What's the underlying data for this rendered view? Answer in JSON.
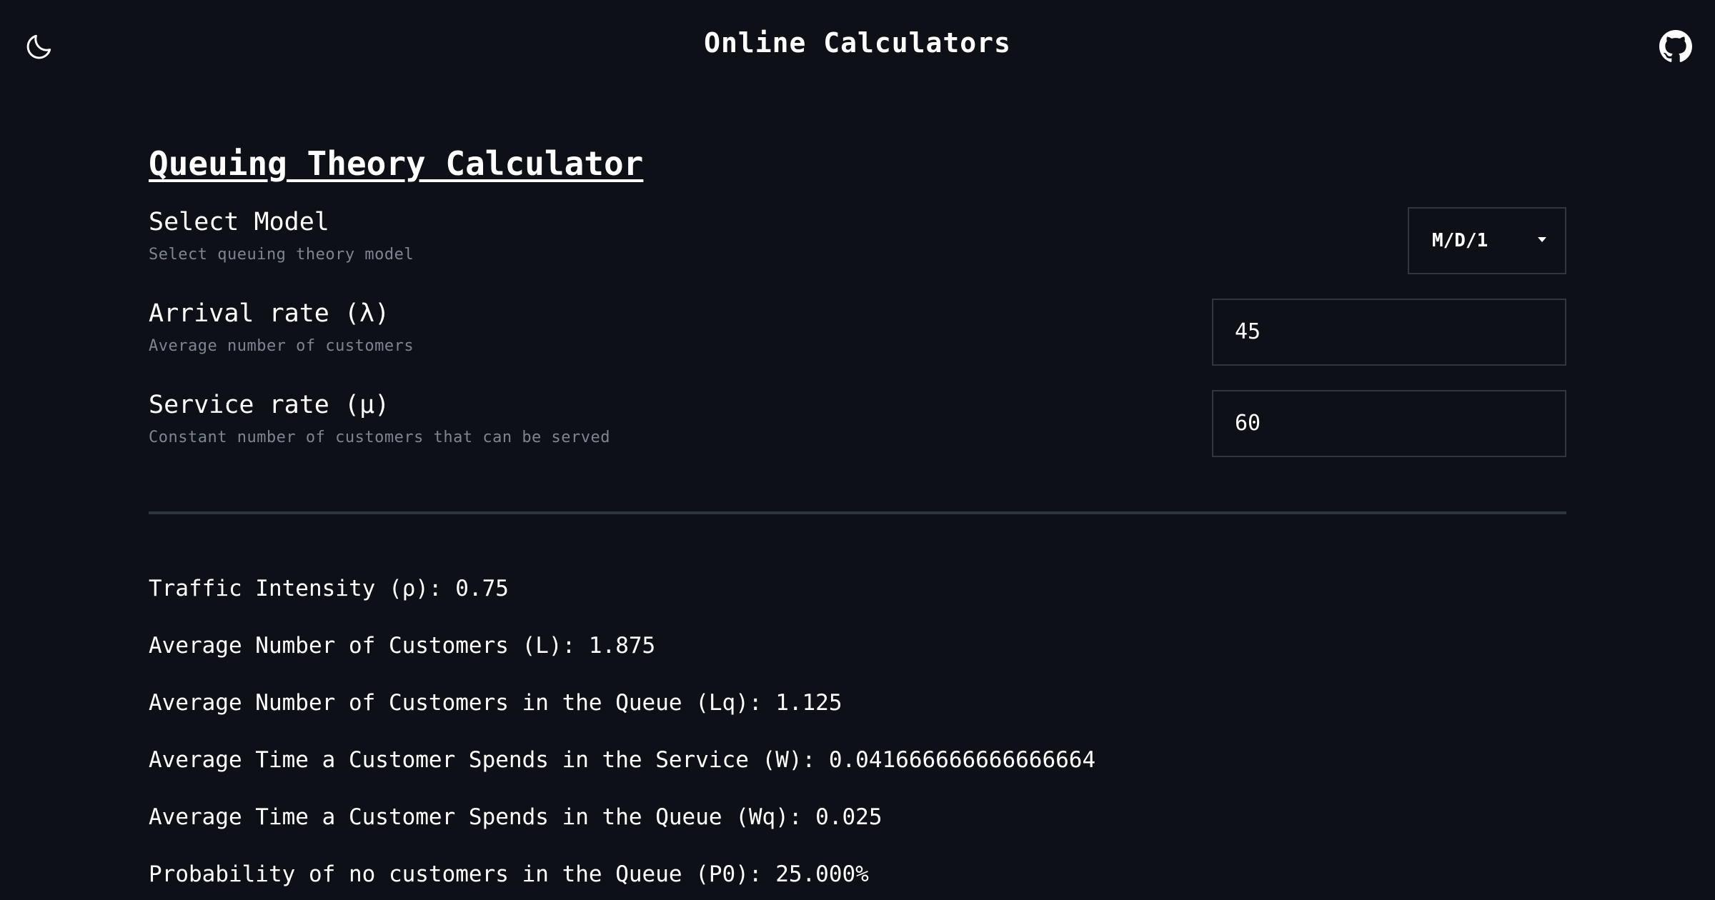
{
  "header": {
    "site_title": "Online Calculators",
    "theme_icon": "moon-icon",
    "github_icon": "github-icon"
  },
  "calculator": {
    "title": "Queuing Theory Calculator",
    "model": {
      "label": "Select Model",
      "hint": "Select queuing theory model",
      "value": "M/D/1"
    },
    "arrival": {
      "label": "Arrival rate (λ)",
      "hint": "Average number of customers",
      "value": "45"
    },
    "service": {
      "label": "Service rate (μ)",
      "hint": "Constant number of customers that can be served",
      "value": "60"
    }
  },
  "results": [
    "Traffic Intensity (ρ): 0.75",
    "Average Number of Customers (L): 1.875",
    "Average Number of Customers in the Queue (Lq): 1.125",
    "Average Time a Customer Spends in the Service (W): 0.041666666666666664",
    "Average Time a Customer Spends in the Queue (Wq): 0.025",
    "Probability of no customers in the Queue (P0): 25.000%"
  ],
  "colors": {
    "background": "#0d1117",
    "border": "#30363d",
    "hint_text": "#7d8590",
    "text": "#ffffff"
  }
}
